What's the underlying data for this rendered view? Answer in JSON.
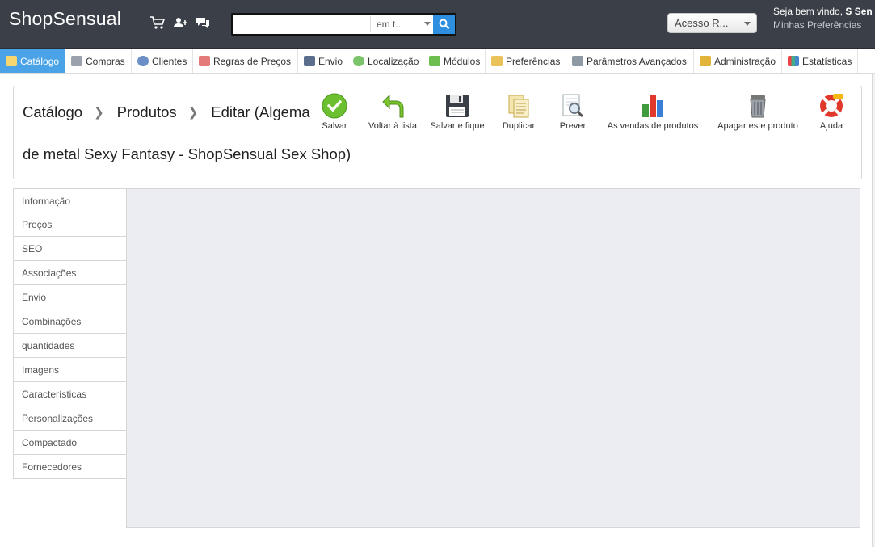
{
  "header": {
    "shop_name": "ShopSensual",
    "icons": [
      "cart-icon",
      "customers-icon",
      "messages-icon"
    ],
    "search": {
      "placeholder": "",
      "scope_label": "em t..."
    },
    "quick_access_label": "Acesso R...",
    "welcome_text": "Seja bem vindo, ",
    "welcome_name": "S Sen",
    "my_preferences": "Minhas Preferências"
  },
  "menu": {
    "items": [
      {
        "label": "Catálogo",
        "icon": "folder-icon",
        "active": true
      },
      {
        "label": "Compras",
        "icon": "cart-icon"
      },
      {
        "label": "Clientes",
        "icon": "customer-icon"
      },
      {
        "label": "Regras de Preços",
        "icon": "price-rules-icon"
      },
      {
        "label": "Envio",
        "icon": "truck-icon"
      },
      {
        "label": "Localização",
        "icon": "globe-icon"
      },
      {
        "label": "Módulos",
        "icon": "puzzle-icon"
      },
      {
        "label": "Preferências",
        "icon": "preferences-icon"
      },
      {
        "label": "Parâmetros Avançados",
        "icon": "wrench-icon"
      },
      {
        "label": "Administração",
        "icon": "key-icon"
      },
      {
        "label": "Estatísticas",
        "icon": "bar-chart-icon"
      }
    ]
  },
  "toolbar": {
    "breadcrumb": [
      "Catálogo",
      "Produtos",
      "Editar (Algema"
    ],
    "title_continuation": "de metal Sexy Fantasy - ShopSensual Sex Shop)",
    "buttons": [
      {
        "label": "Salvar",
        "icon": "save-check-icon"
      },
      {
        "label": "Voltar à lista",
        "icon": "back-arrow-icon"
      },
      {
        "label": "Salvar e fique",
        "icon": "floppy-disk-icon"
      },
      {
        "label": "Duplicar",
        "icon": "duplicate-icon"
      },
      {
        "label": "Prever",
        "icon": "preview-magnifier-icon"
      },
      {
        "label": "As vendas de produtos",
        "icon": "sales-chart-icon"
      },
      {
        "label": "Apagar este produto",
        "icon": "trash-icon"
      },
      {
        "label": "Ajuda",
        "icon": "lifebuoy-icon"
      }
    ]
  },
  "tabs": [
    "Informação",
    "Preços",
    "SEO",
    "Associações",
    "Envio",
    "Combinações",
    "quantidades",
    "Imagens",
    "Características",
    "Personalizações",
    "Compactado",
    "Fornecedores"
  ],
  "colors": {
    "header_bg": "#3b3f47",
    "active_menu": "#4aa3e6",
    "content_bg": "#ebedf3",
    "search_button": "#2e8ee0"
  }
}
